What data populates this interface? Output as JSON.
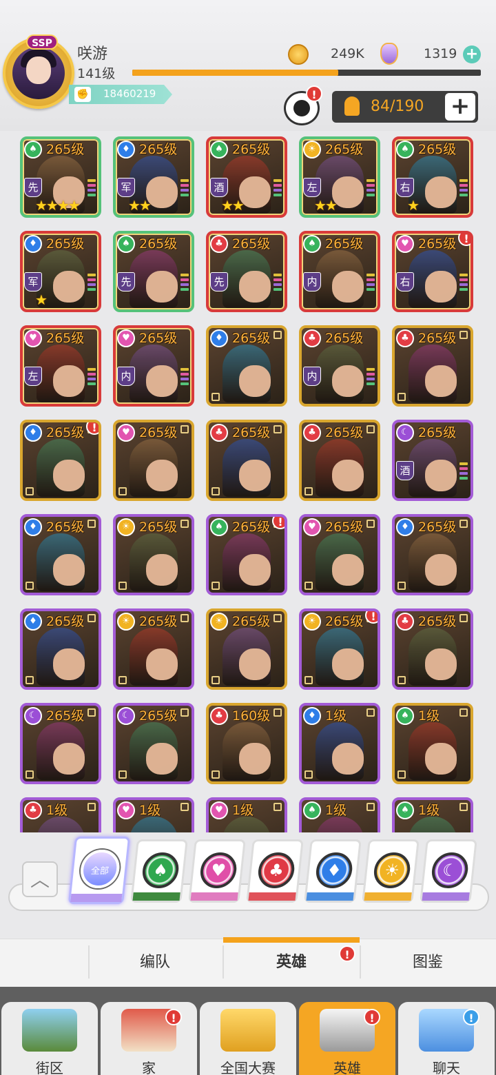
{
  "player": {
    "name": "咲游",
    "level": "141级",
    "badge": "SSP",
    "power": "18460219",
    "exp_fraction": 0.59,
    "coins": "249K",
    "gems": "1319"
  },
  "hero_count": "84/190",
  "heroes": [
    {
      "level": "265级",
      "gem": "spade",
      "role": "先",
      "stars": "★★★★",
      "rarity": "green"
    },
    {
      "level": "265级",
      "gem": "diamond",
      "role": "军",
      "stars": "★★",
      "rarity": "green"
    },
    {
      "level": "265级",
      "gem": "spade",
      "role": "酒",
      "stars": "★★",
      "rarity": "red"
    },
    {
      "level": "265级",
      "gem": "sun",
      "role": "左",
      "stars": "★★",
      "rarity": "green"
    },
    {
      "level": "265级",
      "gem": "spade",
      "role": "右",
      "stars": "★",
      "rarity": "red"
    },
    {
      "level": "265级",
      "gem": "diamond",
      "role": "军",
      "stars": "★",
      "rarity": "red"
    },
    {
      "level": "265级",
      "gem": "spade",
      "role": "先",
      "stars": "",
      "rarity": "green"
    },
    {
      "level": "265级",
      "gem": "club",
      "role": "先",
      "stars": "",
      "rarity": "red"
    },
    {
      "level": "265级",
      "gem": "spade",
      "role": "内",
      "stars": "",
      "rarity": "red"
    },
    {
      "level": "265级",
      "gem": "heart",
      "role": "右",
      "stars": "",
      "rarity": "red",
      "alert": true
    },
    {
      "level": "265级",
      "gem": "heart",
      "role": "左",
      "stars": "",
      "rarity": "red"
    },
    {
      "level": "265级",
      "gem": "heart",
      "role": "内",
      "stars": "",
      "rarity": "red"
    },
    {
      "level": "265级",
      "gem": "diamond",
      "role": "",
      "stars": "",
      "rarity": "gold"
    },
    {
      "level": "265级",
      "gem": "club",
      "role": "内",
      "stars": "",
      "rarity": "gold"
    },
    {
      "level": "265级",
      "gem": "club",
      "role": "",
      "stars": "",
      "rarity": "gold"
    },
    {
      "level": "265级",
      "gem": "diamond",
      "role": "",
      "stars": "",
      "rarity": "gold",
      "alert": true
    },
    {
      "level": "265级",
      "gem": "heart",
      "role": "",
      "stars": "",
      "rarity": "gold"
    },
    {
      "level": "265级",
      "gem": "club",
      "role": "",
      "stars": "",
      "rarity": "gold"
    },
    {
      "level": "265级",
      "gem": "club",
      "role": "",
      "stars": "",
      "rarity": "gold"
    },
    {
      "level": "265级",
      "gem": "moon",
      "role": "酒",
      "stars": "",
      "rarity": "purple"
    },
    {
      "level": "265级",
      "gem": "diamond",
      "role": "",
      "stars": "",
      "rarity": "purple"
    },
    {
      "level": "265级",
      "gem": "sun",
      "role": "",
      "stars": "",
      "rarity": "purple"
    },
    {
      "level": "265级",
      "gem": "spade",
      "role": "",
      "stars": "",
      "rarity": "purple",
      "alert": true
    },
    {
      "level": "265级",
      "gem": "heart",
      "role": "",
      "stars": "",
      "rarity": "purple"
    },
    {
      "level": "265级",
      "gem": "diamond",
      "role": "",
      "stars": "",
      "rarity": "purple"
    },
    {
      "level": "265级",
      "gem": "diamond",
      "role": "",
      "stars": "",
      "rarity": "purple"
    },
    {
      "level": "265级",
      "gem": "sun",
      "role": "",
      "stars": "",
      "rarity": "purple"
    },
    {
      "level": "265级",
      "gem": "sun",
      "role": "",
      "stars": "",
      "rarity": "gold"
    },
    {
      "level": "265级",
      "gem": "sun",
      "role": "",
      "stars": "",
      "rarity": "purple",
      "alert": true
    },
    {
      "level": "265级",
      "gem": "club",
      "role": "",
      "stars": "",
      "rarity": "purple"
    },
    {
      "level": "265级",
      "gem": "moon",
      "role": "",
      "stars": "",
      "rarity": "purple"
    },
    {
      "level": "265级",
      "gem": "moon",
      "role": "",
      "stars": "",
      "rarity": "purple"
    },
    {
      "level": "160级",
      "gem": "club",
      "role": "",
      "stars": "",
      "rarity": "gold"
    },
    {
      "level": "1级",
      "gem": "diamond",
      "role": "",
      "stars": "",
      "rarity": "purple"
    },
    {
      "level": "1级",
      "gem": "spade",
      "role": "",
      "stars": "",
      "rarity": "gold"
    },
    {
      "level": "1级",
      "gem": "club",
      "role": "",
      "stars": "",
      "rarity": "purple"
    },
    {
      "level": "1级",
      "gem": "heart",
      "role": "",
      "stars": "",
      "rarity": "purple"
    },
    {
      "level": "1级",
      "gem": "heart",
      "role": "",
      "stars": "",
      "rarity": "purple"
    },
    {
      "level": "1级",
      "gem": "spade",
      "role": "",
      "stars": "",
      "rarity": "purple"
    },
    {
      "level": "1级",
      "gem": "spade",
      "role": "",
      "stars": "",
      "rarity": "purple"
    }
  ],
  "filters": {
    "all_label": "全部",
    "items": [
      {
        "name": "spade",
        "color": "#2fa84f",
        "bottom": "#3e8a3e"
      },
      {
        "name": "heart",
        "color": "#e04fa8",
        "bottom": "#e07bbf"
      },
      {
        "name": "club",
        "color": "#e03a46",
        "bottom": "#e0525a"
      },
      {
        "name": "diamond",
        "color": "#2f7ee8",
        "bottom": "#4a8ee0"
      },
      {
        "name": "sun",
        "color": "#f1b323",
        "bottom": "#f0b030"
      },
      {
        "name": "moon",
        "color": "#9b4fd6",
        "bottom": "#a77be0"
      }
    ]
  },
  "tabs": [
    "编队",
    "英雄",
    "图鉴"
  ],
  "nav": [
    "街区",
    "家",
    "全国大赛",
    "英雄",
    "聊天"
  ],
  "colors": {
    "spade": "#37b35c",
    "heart": "#e255b0",
    "club": "#e23c44",
    "diamond": "#2f7ee8",
    "sun": "#f1b323",
    "moon": "#9b4fd6",
    "accent": "#f5a623"
  }
}
